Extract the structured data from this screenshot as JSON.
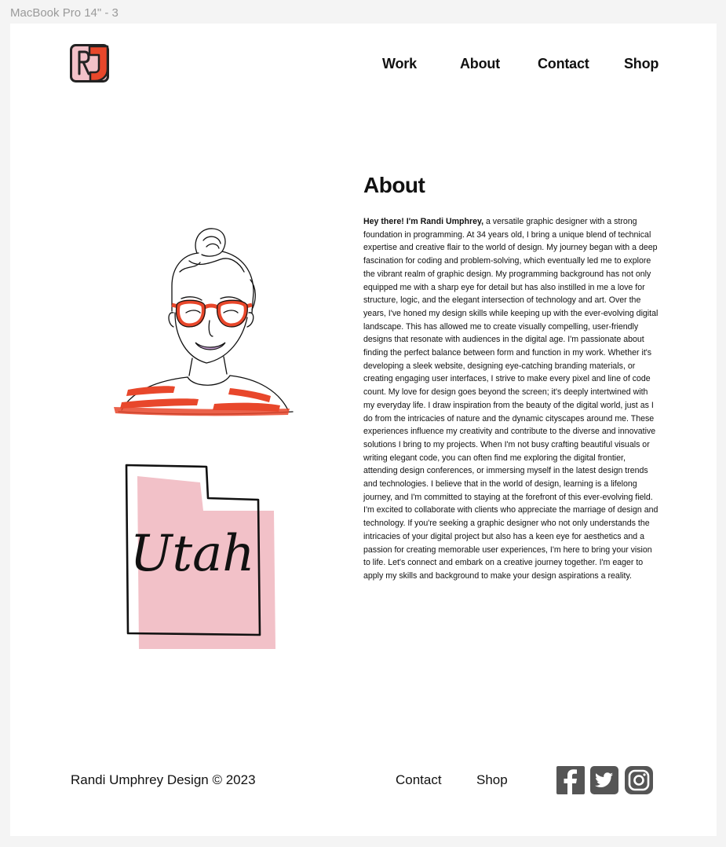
{
  "frame_label": "MacBook Pro 14\" - 3",
  "colors": {
    "accent": "#e8472b",
    "pink": "#f2c1c8",
    "icon_gray": "#555555"
  },
  "header": {
    "logo_icon": "rj-logo",
    "nav": {
      "work": "Work",
      "about": "About",
      "contact": "Contact",
      "shop": "Shop"
    }
  },
  "main": {
    "illustrations": {
      "portrait": "portrait-illustration",
      "utah": "utah-illustration",
      "utah_text": "Utah"
    },
    "about_title": "About",
    "about_intro": "Hey there! I'm Randi Umphrey,",
    "about_body": " a versatile graphic designer with a strong foundation in programming. At 34 years old, I bring a unique blend of technical expertise and creative flair to the world of design. My journey began with a deep fascination for coding and problem-solving, which eventually led me to explore the vibrant realm of graphic design. My programming background has not only equipped me with a sharp eye for detail but has also instilled in me a love for structure, logic, and the elegant intersection of technology and art. Over the years, I've honed my design skills while keeping up with the ever-evolving digital landscape. This has allowed me to create visually compelling, user-friendly designs that resonate with audiences in the digital age. I'm passionate about finding the perfect balance between form and function in my work. Whether it's developing a sleek website, designing eye-catching branding materials, or creating engaging user interfaces, I strive to make every pixel and line of code count. My love for design goes beyond the screen; it's deeply intertwined with my everyday life. I draw inspiration from the beauty of the digital world, just as I do from the intricacies of nature and the dynamic cityscapes around me. These experiences influence my creativity and contribute to the diverse and innovative solutions I bring to my projects. When I'm not busy crafting beautiful visuals or writing elegant code, you can often find me exploring the digital frontier, attending design conferences, or immersing myself in the latest design trends and technologies. I believe that in the world of design, learning is a lifelong journey, and I'm committed to staying at the forefront of this ever-evolving field. I'm excited to collaborate with clients who appreciate the marriage of design and technology. If you're seeking a graphic designer who not only understands the intricacies of your digital project but also has a keen eye for aesthetics and a passion for creating memorable user experiences, I'm here to bring your vision to life. Let's connect and embark on a creative journey together. I'm eager to apply my skills and background to make your design aspirations a reality."
  },
  "footer": {
    "copyright": "Randi Umphrey Design © 2023",
    "links": {
      "contact": "Contact",
      "shop": "Shop"
    },
    "social": [
      "facebook-icon",
      "twitter-icon",
      "instagram-icon"
    ]
  }
}
